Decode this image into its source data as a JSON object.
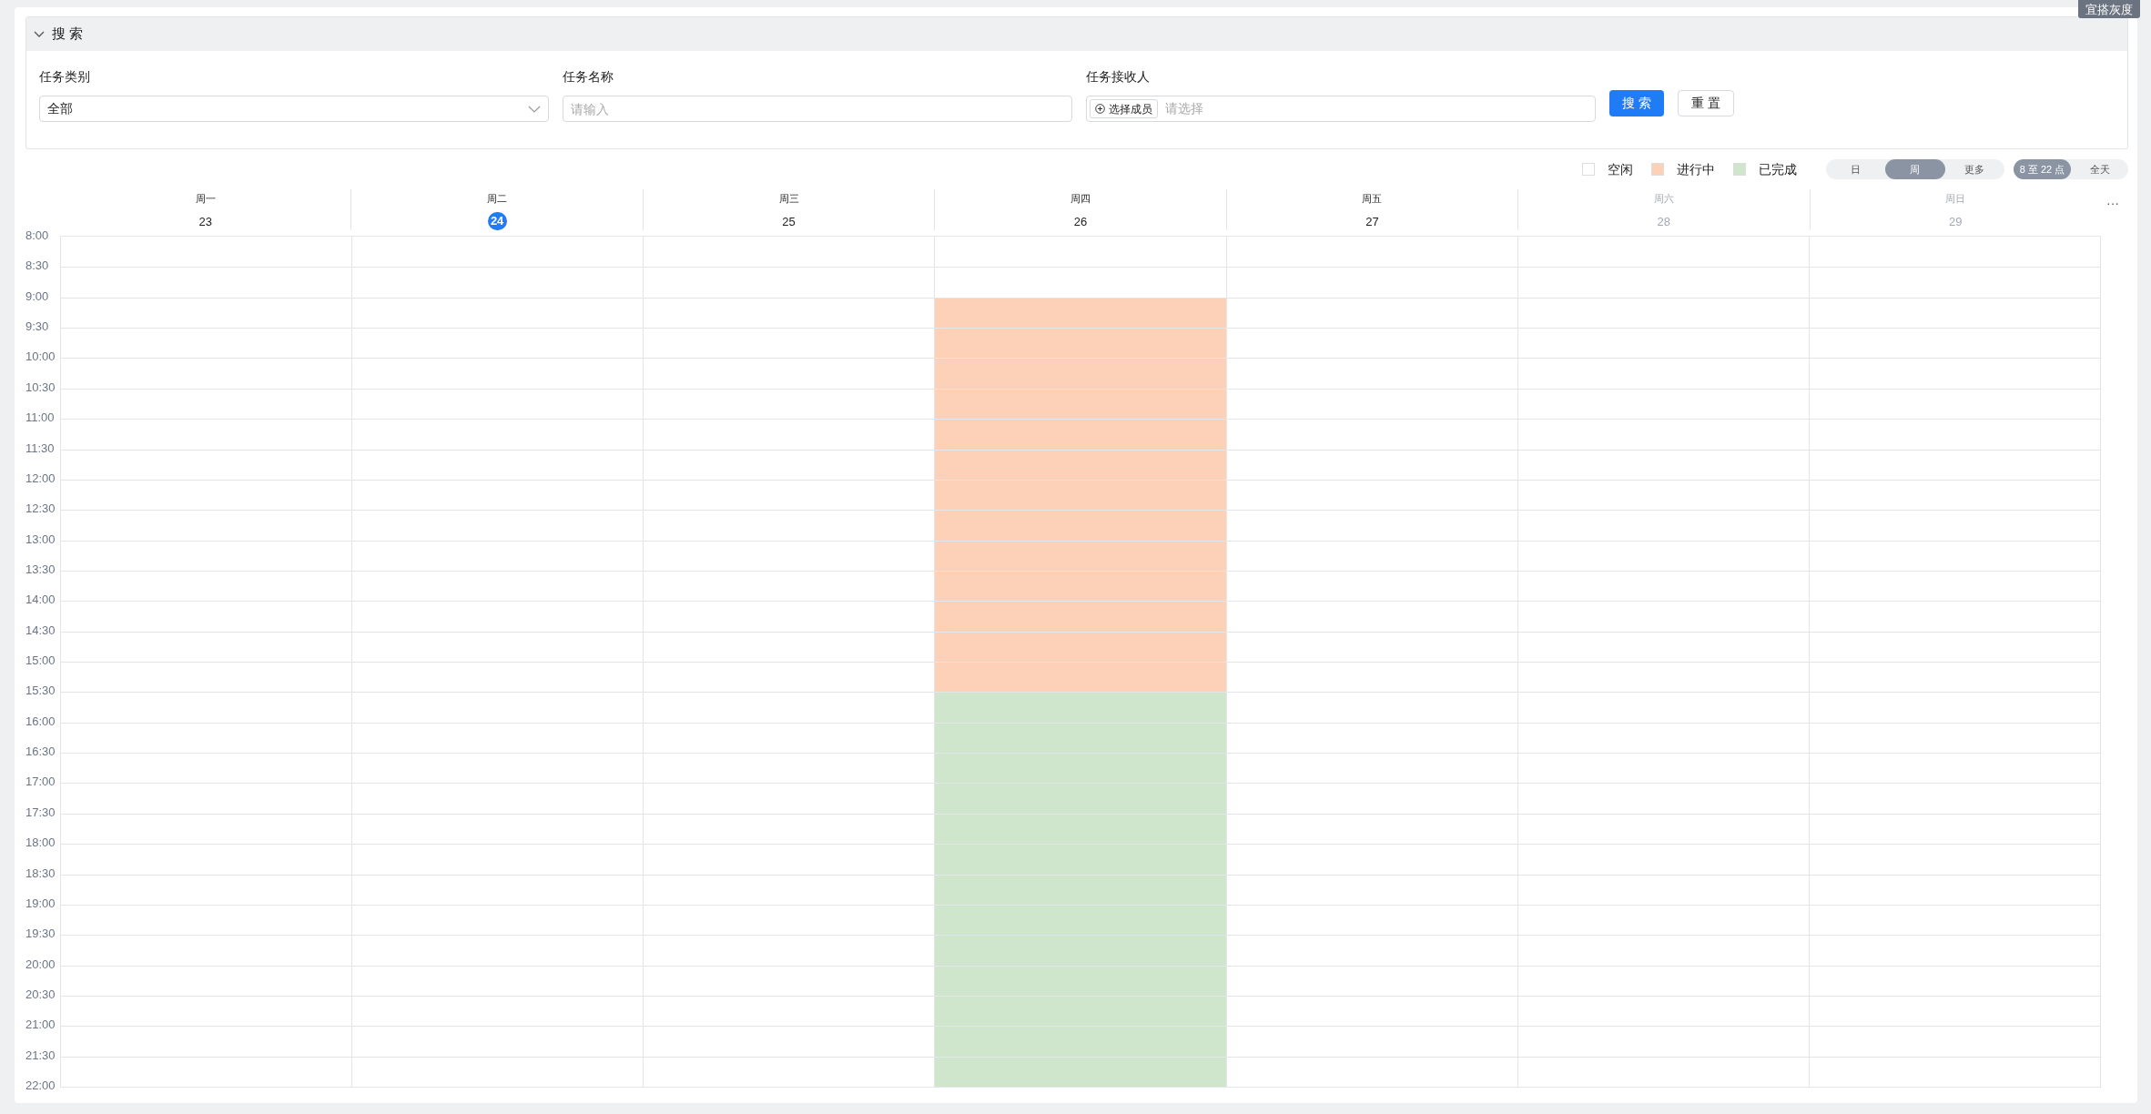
{
  "corner_badge": "宜搭灰度",
  "search_panel": {
    "title": "搜 索",
    "expanded": true,
    "fields": [
      {
        "kind": "select",
        "label": "任务类别",
        "value": "全部"
      },
      {
        "kind": "text",
        "label": "任务名称",
        "placeholder": "请输入"
      },
      {
        "kind": "member",
        "label": "任务接收人",
        "chip": "选择成员",
        "placeholder": "请选择"
      }
    ],
    "buttons": [
      {
        "label": "搜 索",
        "primary": true
      },
      {
        "label": "重 置",
        "primary": false
      }
    ]
  },
  "legend": [
    {
      "label": "空闲",
      "color": "#ffffff"
    },
    {
      "label": "进行中",
      "color": "#fdd0b8"
    },
    {
      "label": "已完成",
      "color": "#cfe6cd"
    }
  ],
  "view_toggle": [
    {
      "label": "日",
      "selected": false
    },
    {
      "label": "周",
      "selected": true
    },
    {
      "label": "更多",
      "selected": false
    }
  ],
  "range_toggle": [
    {
      "label": "8 至 22 点",
      "selected": true
    },
    {
      "label": "全天",
      "selected": false
    }
  ],
  "more": "···",
  "times": [
    "8:00",
    "8:30",
    "9:00",
    "9:30",
    "10:00",
    "10:30",
    "11:00",
    "11:30",
    "12:00",
    "12:30",
    "13:00",
    "13:30",
    "14:00",
    "14:30",
    "15:00",
    "15:30",
    "16:00",
    "16:30",
    "17:00",
    "17:30",
    "18:00",
    "18:30",
    "19:00",
    "19:30",
    "20:00",
    "20:30",
    "21:00",
    "21:30",
    "22:00"
  ],
  "days": [
    {
      "weekday": "周一",
      "date": "23",
      "today": false,
      "muted": false,
      "slots": [
        {
          "kind": "free"
        },
        {
          "kind": "free"
        },
        {
          "kind": "free"
        },
        {
          "kind": "free"
        },
        {
          "kind": "free"
        },
        {
          "kind": "free"
        },
        {
          "kind": "free"
        },
        {
          "kind": "free"
        },
        {
          "kind": "free"
        },
        {
          "kind": "free"
        },
        {
          "kind": "free"
        },
        {
          "kind": "free"
        },
        {
          "kind": "free"
        },
        {
          "kind": "free"
        },
        {
          "kind": "free"
        },
        {
          "kind": "free"
        },
        {
          "kind": "free"
        },
        {
          "kind": "free"
        },
        {
          "kind": "free"
        },
        {
          "kind": "free"
        },
        {
          "kind": "free"
        },
        {
          "kind": "free"
        },
        {
          "kind": "free"
        },
        {
          "kind": "free"
        },
        {
          "kind": "free"
        },
        {
          "kind": "free"
        },
        {
          "kind": "free"
        },
        {
          "kind": "free"
        }
      ]
    },
    {
      "weekday": "周二",
      "date": "24",
      "today": true,
      "muted": false,
      "slots": [
        {
          "kind": "free"
        },
        {
          "kind": "free"
        },
        {
          "kind": "free"
        },
        {
          "kind": "free"
        },
        {
          "kind": "free"
        },
        {
          "kind": "free"
        },
        {
          "kind": "free"
        },
        {
          "kind": "free"
        },
        {
          "kind": "free"
        },
        {
          "kind": "free"
        },
        {
          "kind": "free"
        },
        {
          "kind": "free"
        },
        {
          "kind": "free"
        },
        {
          "kind": "free"
        },
        {
          "kind": "free"
        },
        {
          "kind": "free"
        },
        {
          "kind": "free"
        },
        {
          "kind": "free"
        },
        {
          "kind": "free"
        },
        {
          "kind": "free"
        },
        {
          "kind": "free"
        },
        {
          "kind": "free"
        },
        {
          "kind": "free"
        },
        {
          "kind": "free"
        },
        {
          "kind": "free"
        },
        {
          "kind": "free"
        },
        {
          "kind": "free"
        },
        {
          "kind": "free"
        }
      ]
    },
    {
      "weekday": "周三",
      "date": "25",
      "today": false,
      "muted": false,
      "slots": [
        {
          "kind": "free"
        },
        {
          "kind": "free"
        },
        {
          "kind": "free"
        },
        {
          "kind": "free"
        },
        {
          "kind": "free"
        },
        {
          "kind": "free"
        },
        {
          "kind": "free"
        },
        {
          "kind": "free"
        },
        {
          "kind": "free"
        },
        {
          "kind": "free"
        },
        {
          "kind": "free"
        },
        {
          "kind": "free"
        },
        {
          "kind": "free"
        },
        {
          "kind": "free"
        },
        {
          "kind": "free"
        },
        {
          "kind": "free"
        },
        {
          "kind": "free"
        },
        {
          "kind": "free"
        },
        {
          "kind": "free"
        },
        {
          "kind": "free"
        },
        {
          "kind": "free"
        },
        {
          "kind": "free"
        },
        {
          "kind": "free"
        },
        {
          "kind": "free"
        },
        {
          "kind": "free"
        },
        {
          "kind": "free"
        },
        {
          "kind": "free"
        },
        {
          "kind": "free"
        }
      ]
    },
    {
      "weekday": "周四",
      "date": "26",
      "today": false,
      "muted": false,
      "slots": [
        {
          "kind": "free"
        },
        {
          "kind": "free"
        },
        {
          "kind": "busy"
        },
        {
          "kind": "busy"
        },
        {
          "kind": "busy"
        },
        {
          "kind": "busy"
        },
        {
          "kind": "busy"
        },
        {
          "kind": "busy"
        },
        {
          "kind": "busy"
        },
        {
          "kind": "busy"
        },
        {
          "kind": "busy"
        },
        {
          "kind": "busy"
        },
        {
          "kind": "busy"
        },
        {
          "kind": "busy"
        },
        {
          "kind": "busy"
        },
        {
          "kind": "done"
        },
        {
          "kind": "done"
        },
        {
          "kind": "done"
        },
        {
          "kind": "done"
        },
        {
          "kind": "done"
        },
        {
          "kind": "done"
        },
        {
          "kind": "done"
        },
        {
          "kind": "done"
        },
        {
          "kind": "done"
        },
        {
          "kind": "done"
        },
        {
          "kind": "done"
        },
        {
          "kind": "done"
        },
        {
          "kind": "done"
        }
      ]
    },
    {
      "weekday": "周五",
      "date": "27",
      "today": false,
      "muted": false,
      "slots": [
        {
          "kind": "free"
        },
        {
          "kind": "free"
        },
        {
          "kind": "free"
        },
        {
          "kind": "free"
        },
        {
          "kind": "free"
        },
        {
          "kind": "free"
        },
        {
          "kind": "free"
        },
        {
          "kind": "free"
        },
        {
          "kind": "free"
        },
        {
          "kind": "free"
        },
        {
          "kind": "free"
        },
        {
          "kind": "free"
        },
        {
          "kind": "free"
        },
        {
          "kind": "free"
        },
        {
          "kind": "free"
        },
        {
          "kind": "free"
        },
        {
          "kind": "free"
        },
        {
          "kind": "free"
        },
        {
          "kind": "free"
        },
        {
          "kind": "free"
        },
        {
          "kind": "free"
        },
        {
          "kind": "free"
        },
        {
          "kind": "free"
        },
        {
          "kind": "free"
        },
        {
          "kind": "free"
        },
        {
          "kind": "free"
        },
        {
          "kind": "free"
        },
        {
          "kind": "free"
        }
      ]
    },
    {
      "weekday": "周六",
      "date": "28",
      "today": false,
      "muted": true,
      "slots": [
        {
          "kind": "free"
        },
        {
          "kind": "free"
        },
        {
          "kind": "free"
        },
        {
          "kind": "free"
        },
        {
          "kind": "free"
        },
        {
          "kind": "free"
        },
        {
          "kind": "free"
        },
        {
          "kind": "free"
        },
        {
          "kind": "free"
        },
        {
          "kind": "free"
        },
        {
          "kind": "free"
        },
        {
          "kind": "free"
        },
        {
          "kind": "free"
        },
        {
          "kind": "free"
        },
        {
          "kind": "free"
        },
        {
          "kind": "free"
        },
        {
          "kind": "free"
        },
        {
          "kind": "free"
        },
        {
          "kind": "free"
        },
        {
          "kind": "free"
        },
        {
          "kind": "free"
        },
        {
          "kind": "free"
        },
        {
          "kind": "free"
        },
        {
          "kind": "free"
        },
        {
          "kind": "free"
        },
        {
          "kind": "free"
        },
        {
          "kind": "free"
        },
        {
          "kind": "free"
        }
      ]
    },
    {
      "weekday": "周日",
      "date": "29",
      "today": false,
      "muted": true,
      "slots": [
        {
          "kind": "free"
        },
        {
          "kind": "free"
        },
        {
          "kind": "free"
        },
        {
          "kind": "free"
        },
        {
          "kind": "free"
        },
        {
          "kind": "free"
        },
        {
          "kind": "free"
        },
        {
          "kind": "free"
        },
        {
          "kind": "free"
        },
        {
          "kind": "free"
        },
        {
          "kind": "free"
        },
        {
          "kind": "free"
        },
        {
          "kind": "free"
        },
        {
          "kind": "free"
        },
        {
          "kind": "free"
        },
        {
          "kind": "free"
        },
        {
          "kind": "free"
        },
        {
          "kind": "free"
        },
        {
          "kind": "free"
        },
        {
          "kind": "free"
        },
        {
          "kind": "free"
        },
        {
          "kind": "free"
        },
        {
          "kind": "free"
        },
        {
          "kind": "free"
        },
        {
          "kind": "free"
        },
        {
          "kind": "free"
        },
        {
          "kind": "free"
        },
        {
          "kind": "free"
        }
      ]
    }
  ]
}
